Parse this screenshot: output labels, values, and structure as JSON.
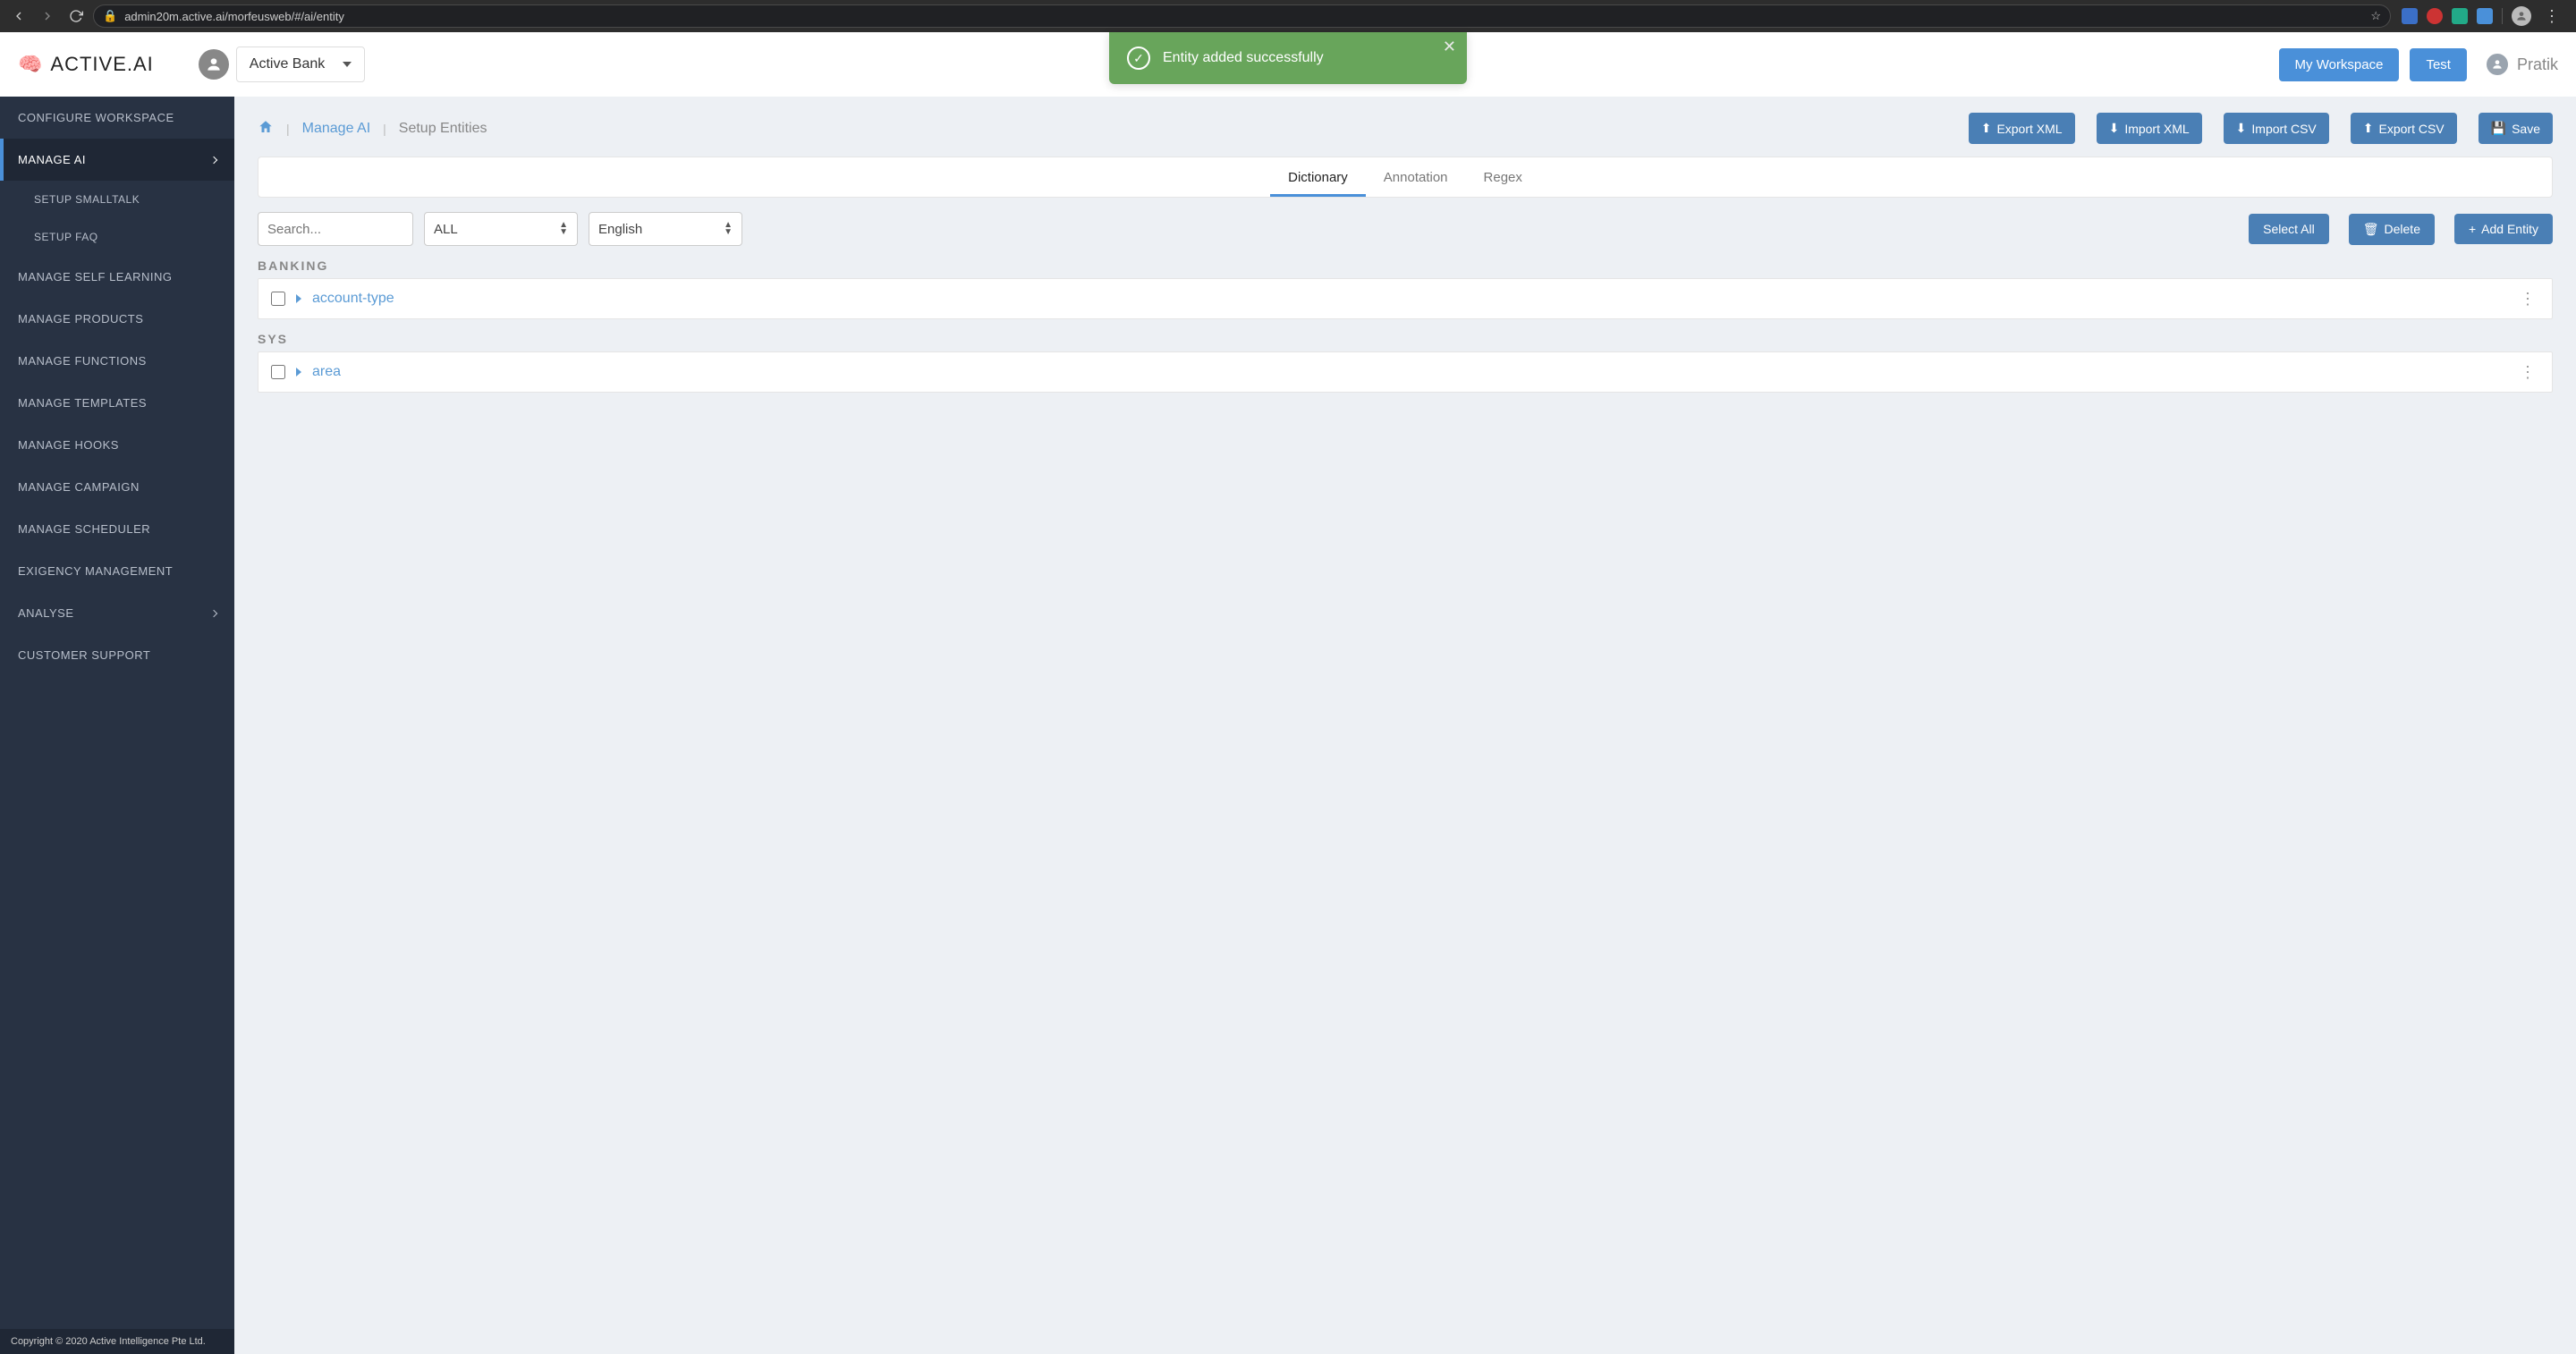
{
  "browser": {
    "url": "admin20m.active.ai/morfeusweb/#/ai/entity"
  },
  "header": {
    "logo": "ACTIVE.AI",
    "bank": "Active Bank",
    "workspace_btn": "My Workspace",
    "test_btn": "Test",
    "user": "Pratik"
  },
  "toast": {
    "message": "Entity added successfully"
  },
  "sidebar": {
    "items": [
      "CONFIGURE WORKSPACE",
      "MANAGE AI",
      "SETUP SMALLTALK",
      "SETUP FAQ",
      "MANAGE SELF LEARNING",
      "MANAGE PRODUCTS",
      "MANAGE FUNCTIONS",
      "MANAGE TEMPLATES",
      "MANAGE HOOKS",
      "MANAGE CAMPAIGN",
      "MANAGE SCHEDULER",
      "EXIGENCY MANAGEMENT",
      "ANALYSE",
      "CUSTOMER SUPPORT"
    ],
    "copyright": "Copyright © 2020 Active Intelligence Pte Ltd."
  },
  "breadcrumb": {
    "link": "Manage AI",
    "current": "Setup Entities"
  },
  "actions": {
    "export_xml": "Export XML",
    "import_xml": "Import XML",
    "import_csv": "Import CSV",
    "export_csv": "Export CSV",
    "save": "Save"
  },
  "tabs": {
    "dictionary": "Dictionary",
    "annotation": "Annotation",
    "regex": "Regex"
  },
  "filters": {
    "search_placeholder": "Search...",
    "type": "ALL",
    "language": "English",
    "select_all": "Select All",
    "delete": "Delete",
    "add_entity": "Add Entity"
  },
  "groups": [
    {
      "name": "BANKING",
      "entities": [
        "account-type"
      ]
    },
    {
      "name": "SYS",
      "entities": [
        "area"
      ]
    }
  ]
}
